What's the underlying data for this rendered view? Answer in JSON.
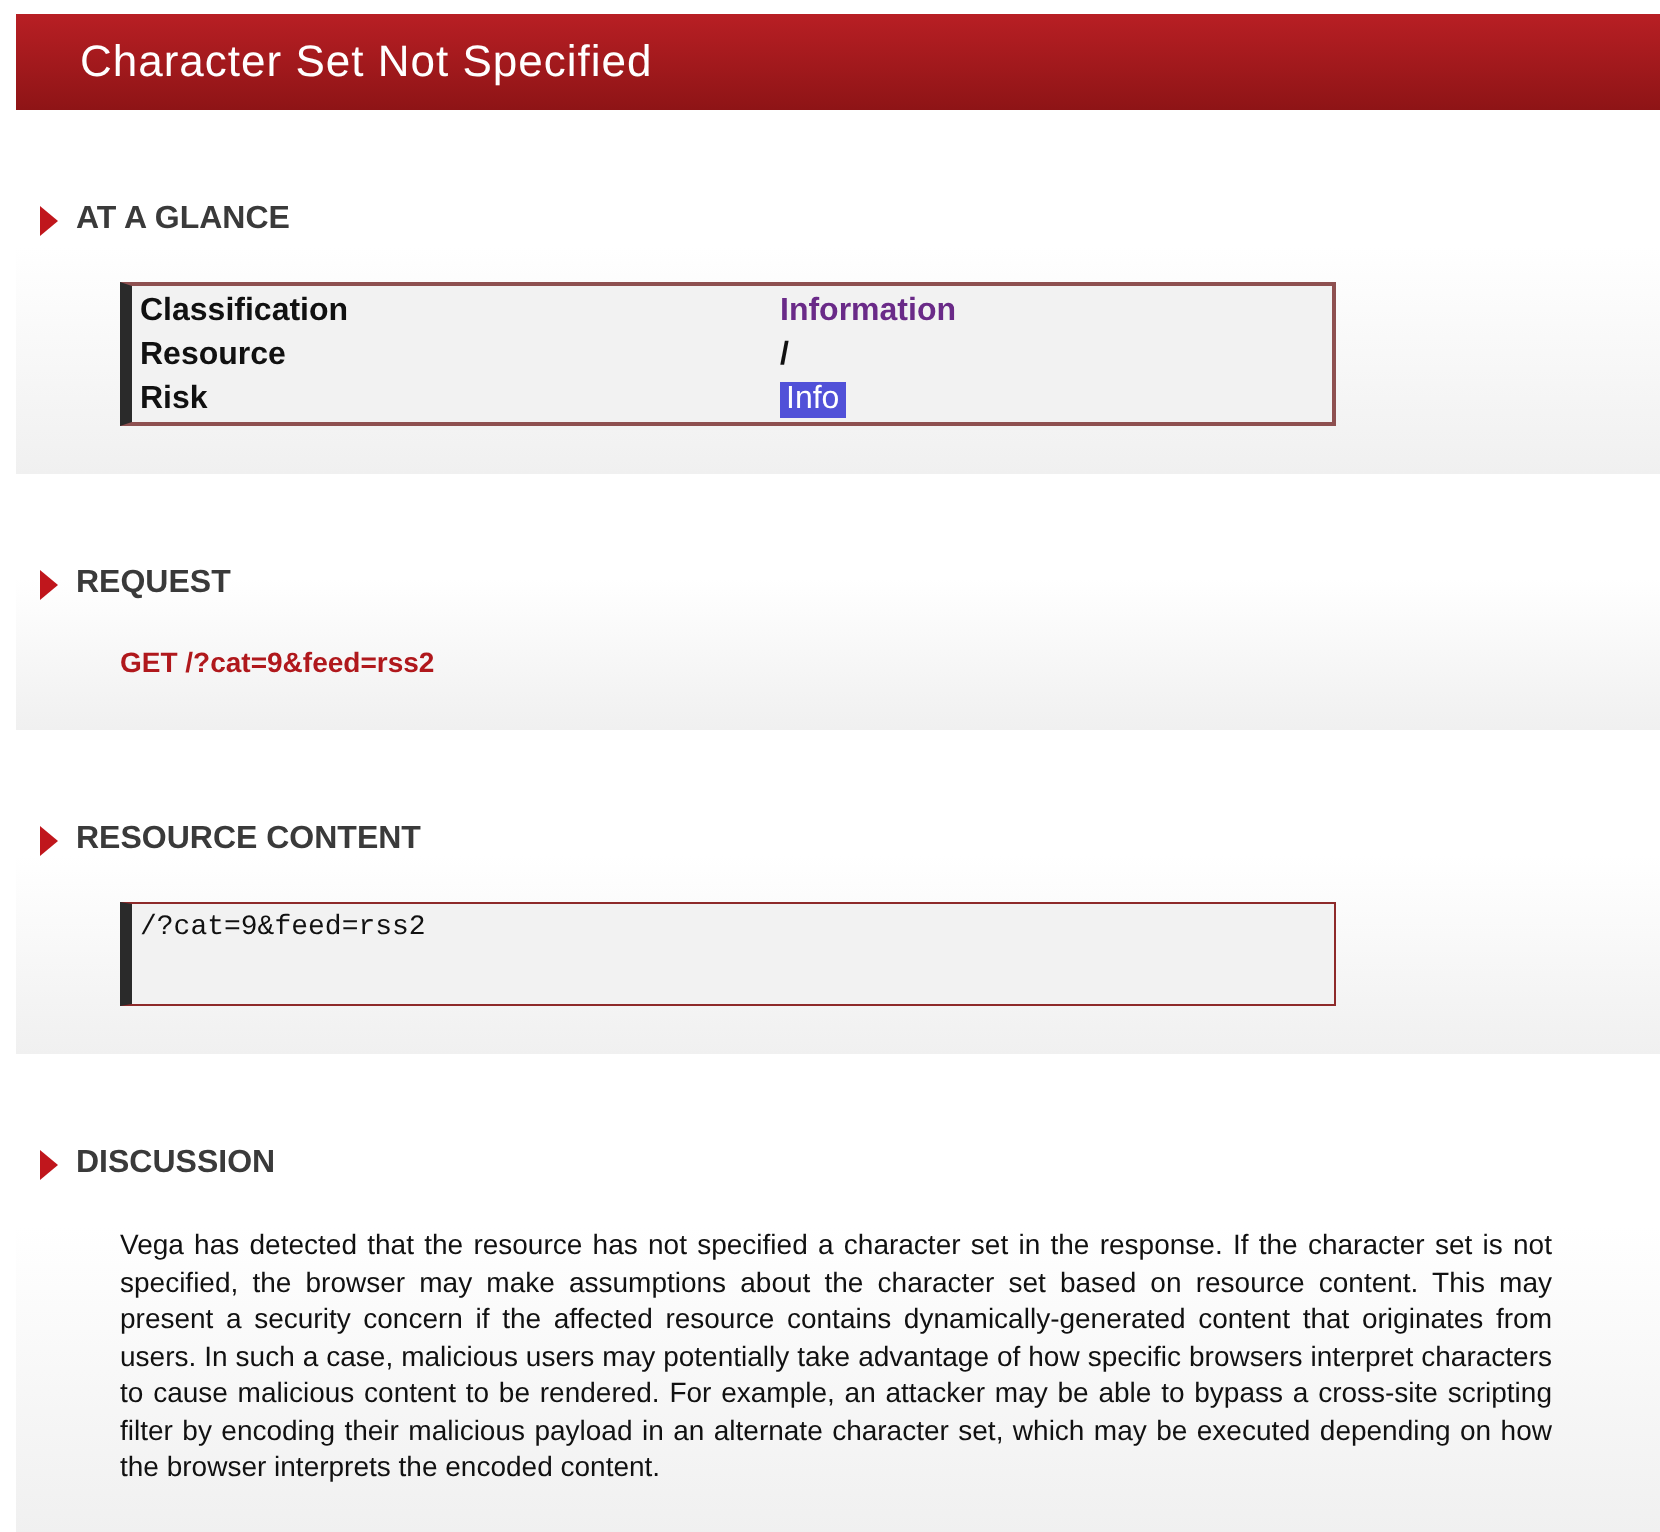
{
  "title": "Character Set Not Specified",
  "sections": [
    {
      "kind": "glance",
      "heading": "AT A GLANCE",
      "rows": [
        {
          "label": "Classification",
          "value": "Information",
          "kind": "class"
        },
        {
          "label": "Resource",
          "value": "/",
          "kind": "plain"
        },
        {
          "label": "Risk",
          "value": "Info",
          "kind": "risk"
        }
      ]
    },
    {
      "kind": "request",
      "heading": "REQUEST",
      "text": "GET /?cat=9&feed=rss2"
    },
    {
      "kind": "content",
      "heading": "RESOURCE CONTENT",
      "text": "/?cat=9&feed=rss2"
    },
    {
      "kind": "discussion",
      "heading": "DISCUSSION",
      "text": "Vega has detected that the resource has not specified a character set in the response. If the character set is not specified, the browser may make assumptions about the character set based on resource content. This may present a security concern if the affected resource contains dynamically-generated content that originates from users. In such a case, malicious users may potentially take advantage of how specific browsers interpret characters to cause malicious content to be rendered. For example, an attacker may be able to bypass a cross-site scripting filter by encoding their malicious payload in an alternate character set, which may be executed depending on how the browser interprets the encoded content."
    }
  ]
}
